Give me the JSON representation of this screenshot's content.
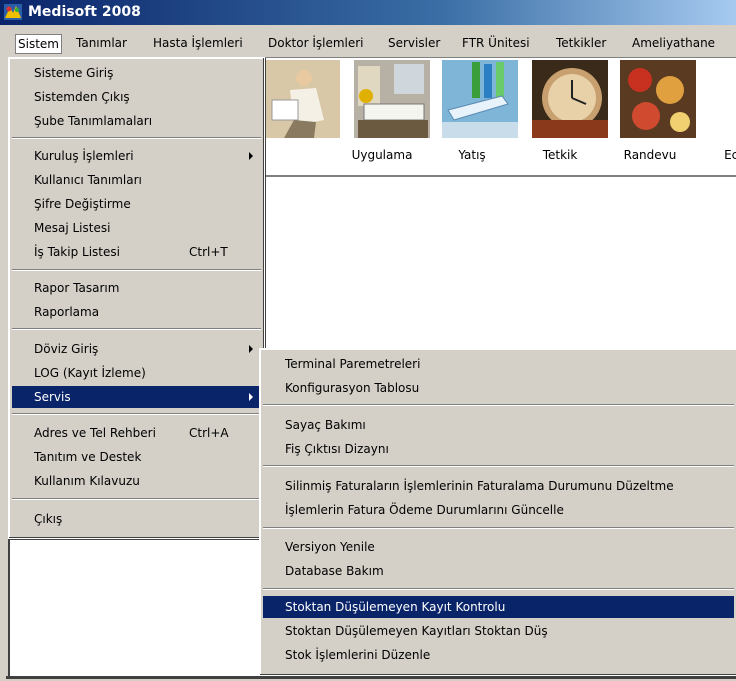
{
  "window": {
    "title": "Medisoft 2008"
  },
  "menubar": [
    "Sistem",
    "Tanımlar",
    "Hasta İşlemleri",
    "Doktor İşlemleri",
    "Servisler",
    "FTR Ünitesi",
    "Tetkikler",
    "Ameliyathane"
  ],
  "toolbar": [
    "Uygulama",
    "Yatış",
    "Tetkik",
    "Randevu",
    "Ecza"
  ],
  "sistem_menu": {
    "items": [
      {
        "label": "Sisteme Giriş"
      },
      {
        "label": "Sistemden Çıkış"
      },
      {
        "label": "Şube Tanımlamaları"
      },
      {
        "label": "Kuruluş İşlemleri"
      },
      {
        "label": "Kullanıcı Tanımları"
      },
      {
        "label": "Şifre Değiştirme"
      },
      {
        "label": "Mesaj Listesi"
      },
      {
        "label": "İş Takip Listesi",
        "shortcut": "Ctrl+T"
      },
      {
        "label": "Rapor Tasarım"
      },
      {
        "label": "Raporlama"
      },
      {
        "label": "Döviz Giriş"
      },
      {
        "label": "LOG (Kayıt İzleme)"
      },
      {
        "label": "Servis"
      },
      {
        "label": "Adres ve Tel Rehberi",
        "shortcut": "Ctrl+A"
      },
      {
        "label": "Tanıtım ve Destek"
      },
      {
        "label": "Kullanım Kılavuzu"
      },
      {
        "label": "Çıkış"
      }
    ]
  },
  "servis_menu": {
    "items": [
      {
        "label": "Terminal Paremetreleri"
      },
      {
        "label": "Konfigurasyon Tablosu"
      },
      {
        "label": "Sayaç Bakımı"
      },
      {
        "label": "Fiş Çıktısı Dizaynı"
      },
      {
        "label": "Silinmiş Faturaların İşlemlerinin Faturalama Durumunu Düzeltme"
      },
      {
        "label": "İşlemlerin Fatura Ödeme Durumlarını Güncelle"
      },
      {
        "label": "Versiyon Yenile"
      },
      {
        "label": "Database Bakım"
      },
      {
        "label": "Stoktan Düşülemeyen Kayıt Kontrolu"
      },
      {
        "label": "Stoktan Düşülemeyen Kayıtları Stoktan Düş"
      },
      {
        "label": "Stok İşlemlerini Düzenle"
      }
    ]
  },
  "colors": {
    "highlight": "#0a246a",
    "title_start": "#0a246a",
    "menu_bg": "#d4d0c8"
  }
}
